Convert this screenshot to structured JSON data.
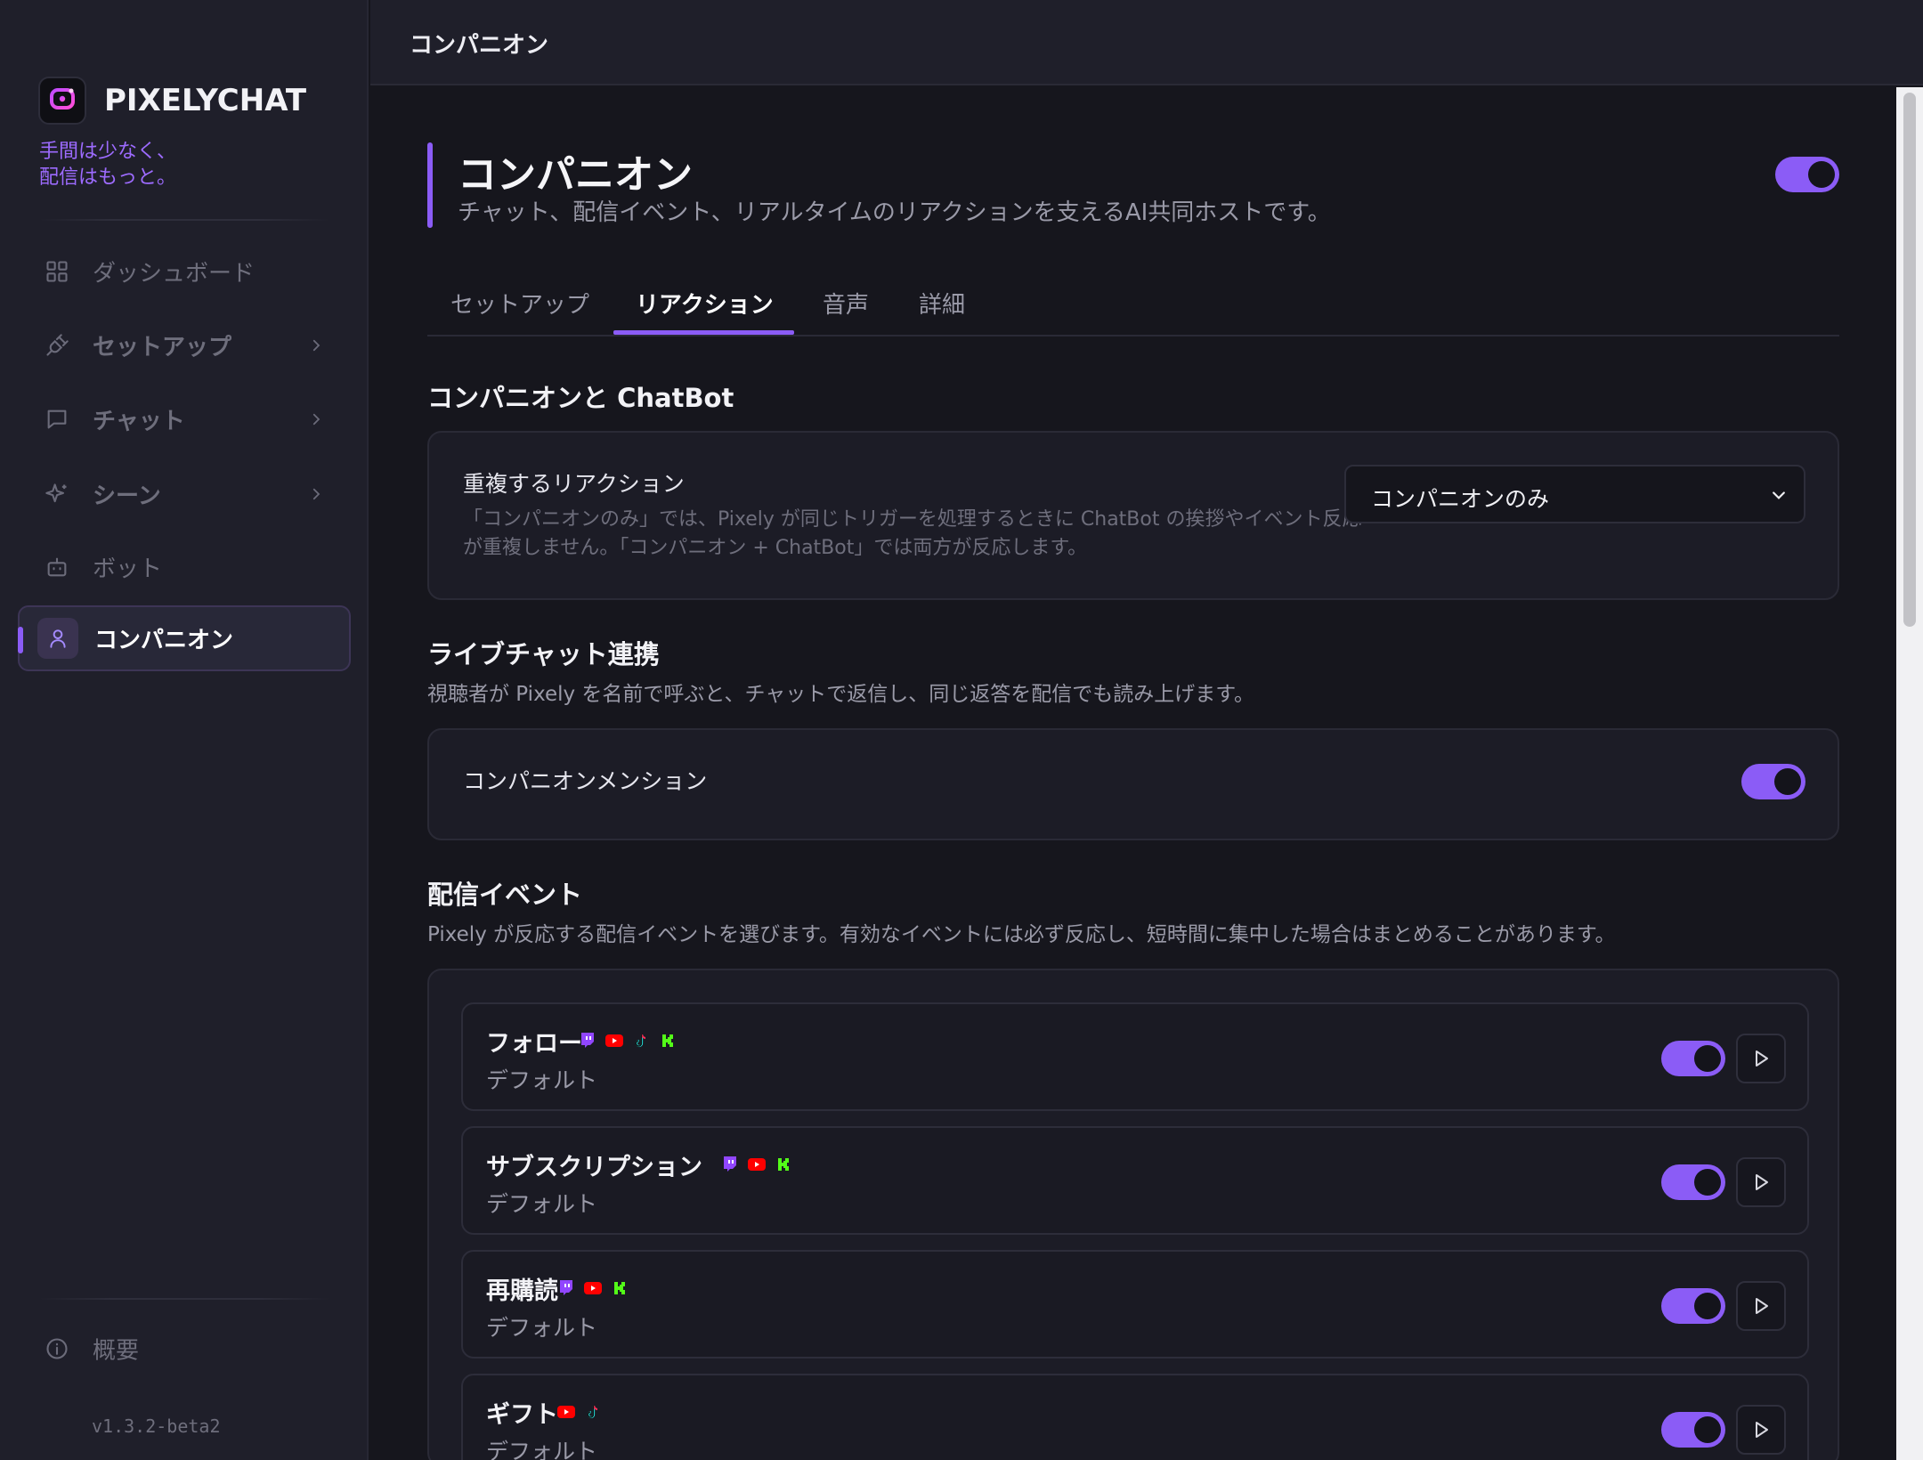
{
  "app": {
    "name": "PIXELYCHAT",
    "tagline_line1": "手間は少なく、",
    "tagline_line2": "配信はもっと。",
    "version": "v1.3.2-beta2",
    "accent_color": "#8b5cf6"
  },
  "sidebar": {
    "items": [
      {
        "label": "ダッシュボード",
        "icon": "grid-icon"
      },
      {
        "label": "セットアップ",
        "icon": "plug-icon"
      },
      {
        "label": "チャット",
        "icon": "chat-bubble-icon"
      },
      {
        "label": "シーン",
        "icon": "sparkle-icon"
      },
      {
        "label": "ボット",
        "icon": "robot-icon"
      },
      {
        "label": "コンパニオン",
        "icon": "user-icon",
        "active": true
      }
    ],
    "about_label": "概要"
  },
  "topbar": {
    "title": "コンパニオン"
  },
  "header": {
    "title": "コンパニオン",
    "subtitle": "チャット、配信イベント、リアルタイムのリアクションを支えるAI共同ホストです。",
    "enabled": true
  },
  "tabs": [
    {
      "label": "セットアップ"
    },
    {
      "label": "リアクション",
      "active": true
    },
    {
      "label": "音声"
    },
    {
      "label": "詳細"
    }
  ],
  "companion_chatbot": {
    "title": "コンパニオンと ChatBot",
    "duplicate_label": "重複するリアクション",
    "duplicate_help": "「コンパニオンのみ」では、Pixely が同じトリガーを処理するときに ChatBot の挨拶やイベント反応が重複しません。「コンパニオン + ChatBot」では両方が反応します。",
    "duplicate_value": "コンパニオンのみ"
  },
  "live_chat": {
    "title": "ライブチャット連携",
    "desc": "視聴者が Pixely を名前で呼ぶと、チャットで返信し、同じ返答を配信でも読み上げます。",
    "mention_label": "コンパニオンメンション",
    "mention_enabled": true
  },
  "stream_events": {
    "title": "配信イベント",
    "desc": "Pixely が反応する配信イベントを選びます。有効なイベントには必ず反応し、短時間に集中した場合はまとめることがあります。",
    "events": [
      {
        "name": "フォロー",
        "sub": "デフォルト",
        "enabled": true,
        "platforms": [
          "twitch-icon",
          "youtube-icon",
          "tiktok-icon",
          "kick-icon"
        ]
      },
      {
        "name": "サブスクリプション",
        "sub": "デフォルト",
        "enabled": true,
        "platforms": [
          "twitch-icon",
          "youtube-icon",
          "kick-icon"
        ]
      },
      {
        "name": "再購読",
        "sub": "デフォルト",
        "enabled": true,
        "platforms": [
          "twitch-icon",
          "youtube-icon",
          "kick-icon"
        ]
      },
      {
        "name": "ギフト",
        "sub": "デフォルト",
        "enabled": true,
        "platforms": [
          "youtube-icon",
          "tiktok-icon"
        ]
      }
    ]
  },
  "platform_colors": {
    "twitch": "#9146ff",
    "youtube": "#ff0000",
    "tiktok": "#111111",
    "kick": "#53fc18"
  }
}
